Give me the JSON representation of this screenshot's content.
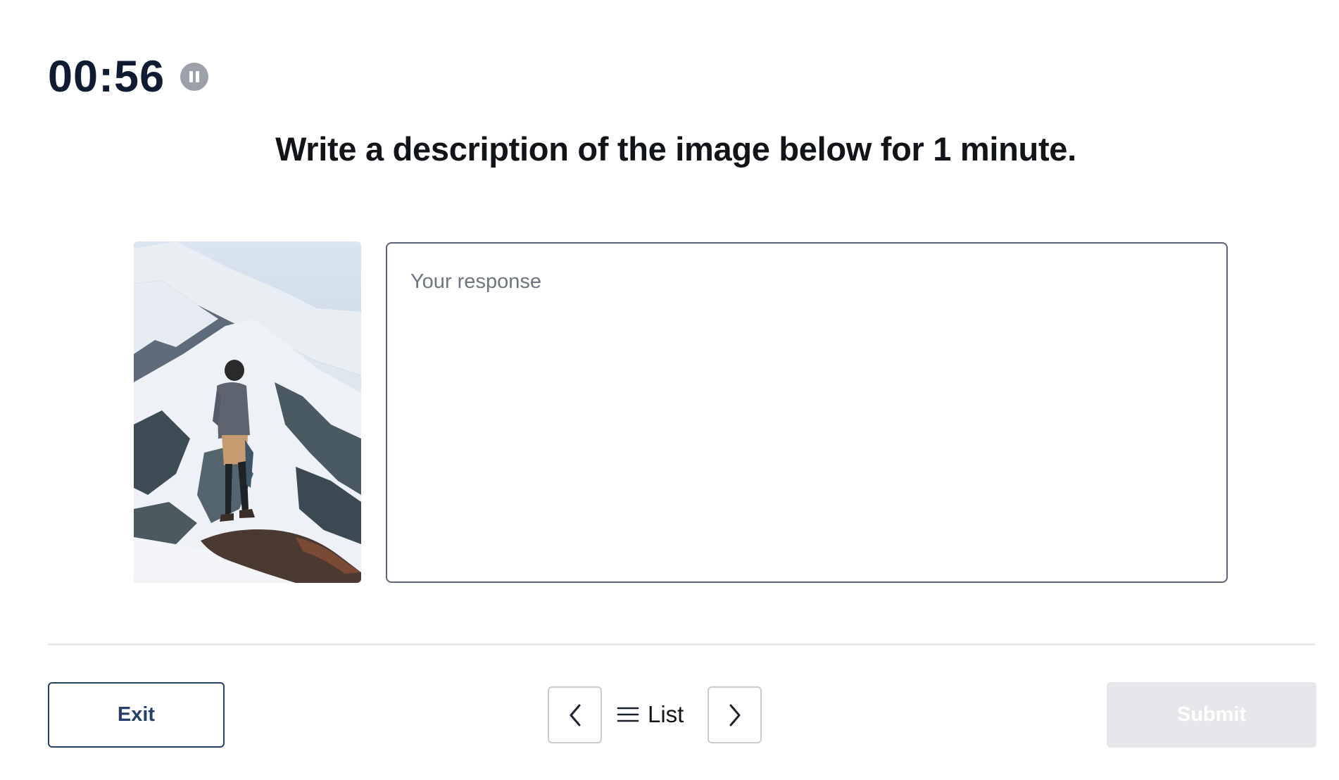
{
  "timer": {
    "time": "00:56",
    "pause_icon": "pause-icon"
  },
  "prompt": {
    "instruction": "Write a description of the image below for 1 minute."
  },
  "image": {
    "subject": "hiker-on-snowy-mountain-photo"
  },
  "response": {
    "placeholder": "Your response",
    "value": ""
  },
  "footer": {
    "exit_label": "Exit",
    "prev_icon": "chevron-left-icon",
    "list_icon": "hamburger-list-icon",
    "list_label": "List",
    "next_icon": "chevron-right-icon",
    "submit_label": "Submit",
    "submit_enabled": false
  },
  "colors": {
    "timer": "#0f1c33",
    "pause_button": "#9ca0a8",
    "exit_border": "#25416a",
    "submit_disabled_bg": "#e5e7eb",
    "divider": "#e7e8eb"
  }
}
